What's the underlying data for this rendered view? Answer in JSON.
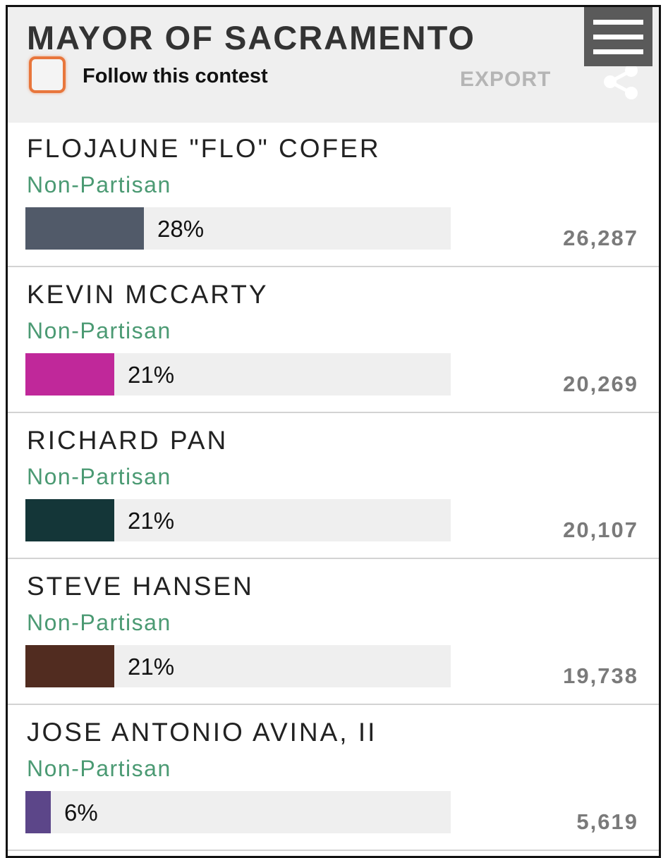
{
  "contest": {
    "title": "MAYOR OF SACRAMENTO",
    "follow_label": "Follow this contest",
    "export_label": "EXPORT"
  },
  "icons": {
    "menu": "hamburger-menu-icon",
    "share": "share-icon",
    "follow_checkbox": "checkbox-icon"
  },
  "colors": {
    "party_text": "#4b9a73",
    "checkbox_border": "#e8763c",
    "menu_button": "#5a5a5a"
  },
  "candidates": [
    {
      "name": "FLOJAUNE \"FLO\" COFER",
      "party": "Non-Partisan",
      "percent": "28%",
      "percent_value": 28,
      "votes": "26,287",
      "color": "#515a69"
    },
    {
      "name": "KEVIN MCCARTY",
      "party": "Non-Partisan",
      "percent": "21%",
      "percent_value": 21,
      "votes": "20,269",
      "color": "#c0289a"
    },
    {
      "name": "RICHARD PAN",
      "party": "Non-Partisan",
      "percent": "21%",
      "percent_value": 21,
      "votes": "20,107",
      "color": "#143638"
    },
    {
      "name": "STEVE HANSEN",
      "party": "Non-Partisan",
      "percent": "21%",
      "percent_value": 21,
      "votes": "19,738",
      "color": "#512c20"
    },
    {
      "name": "JOSE ANTONIO AVINA, II",
      "party": "Non-Partisan",
      "percent": "6%",
      "percent_value": 6,
      "votes": "5,619",
      "color": "#5c4689"
    }
  ]
}
